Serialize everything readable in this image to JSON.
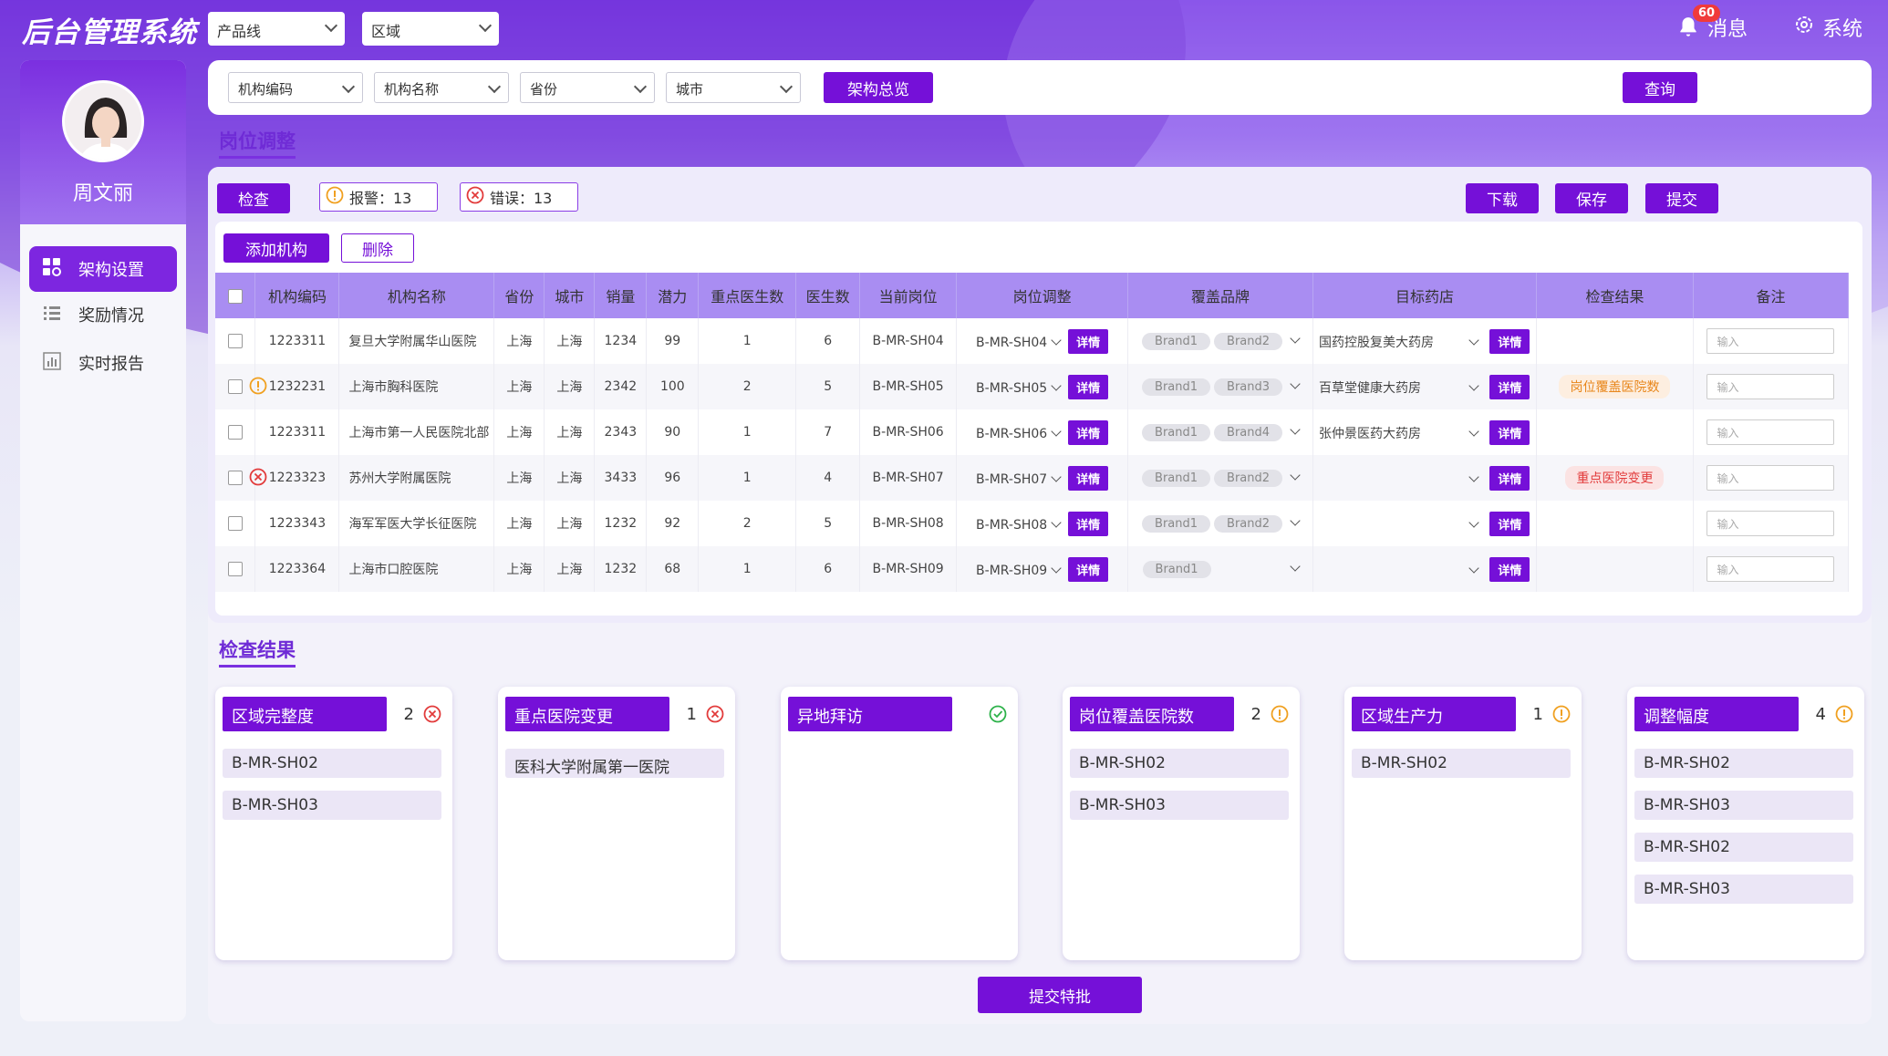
{
  "app": {
    "title": "后台管理系统",
    "product_line": "产品线",
    "region": "区域",
    "messages_label": "消息",
    "messages_count": "60",
    "system_label": "系统"
  },
  "user": {
    "name": "周文丽"
  },
  "nav": [
    {
      "label": "架构设置"
    },
    {
      "label": "奖励情况"
    },
    {
      "label": "实时报告"
    }
  ],
  "filters": {
    "org_code": "机构编码",
    "org_name": "机构名称",
    "province": "省份",
    "city": "城市",
    "overview_button": "架构总览",
    "query_button": "查询"
  },
  "section1": {
    "title": "岗位调整",
    "check_button": "检查",
    "warning_label": "报警：13",
    "error_label": "错误：13",
    "download_button": "下载",
    "save_button": "保存",
    "submit_button": "提交",
    "add_org_button": "添加机构",
    "delete_button": "删除"
  },
  "table": {
    "headers": [
      "机构编码",
      "机构名称",
      "省份",
      "城市",
      "销量",
      "潜力",
      "重点医生数",
      "医生数",
      "当前岗位",
      "岗位调整",
      "覆盖品牌",
      "目标药店",
      "检查结果",
      "备注"
    ],
    "detail_label": "详情",
    "remark_placeholder": "输入",
    "rows": [
      {
        "status": "",
        "code": "1223311",
        "name": "复旦大学附属华山医院",
        "province": "上海",
        "city": "上海",
        "sales": "1234",
        "potential": "99",
        "key_doctors": "1",
        "doctors": "6",
        "current": "B-MR-SH04",
        "adjust": "B-MR-SH04",
        "brand1": "Brand1",
        "brand2": "Brand2",
        "pharmacy": "国药控股复美大药房",
        "result": ""
      },
      {
        "status": "warning",
        "code": "1232231",
        "name": "上海市胸科医院",
        "province": "上海",
        "city": "上海",
        "sales": "2342",
        "potential": "100",
        "key_doctors": "2",
        "doctors": "5",
        "current": "B-MR-SH05",
        "adjust": "B-MR-SH05",
        "brand1": "Brand1",
        "brand2": "Brand3",
        "pharmacy": "百草堂健康大药房",
        "result": "岗位覆盖医院数",
        "result_type": "orange"
      },
      {
        "status": "",
        "code": "1223311",
        "name": "上海市第一人民医院北部",
        "province": "上海",
        "city": "上海",
        "sales": "2343",
        "potential": "90",
        "key_doctors": "1",
        "doctors": "7",
        "current": "B-MR-SH06",
        "adjust": "B-MR-SH06",
        "brand1": "Brand1",
        "brand2": "Brand4",
        "pharmacy": "张仲景医药大药房",
        "result": ""
      },
      {
        "status": "error",
        "code": "1223323",
        "name": "苏州大学附属医院",
        "province": "上海",
        "city": "上海",
        "sales": "3433",
        "potential": "96",
        "key_doctors": "1",
        "doctors": "4",
        "current": "B-MR-SH07",
        "adjust": "B-MR-SH07",
        "brand1": "Brand1",
        "brand2": "Brand2",
        "pharmacy": "",
        "result": "重点医院变更",
        "result_type": "red"
      },
      {
        "status": "",
        "code": "1223343",
        "name": "海军军医大学长征医院",
        "province": "上海",
        "city": "上海",
        "sales": "1232",
        "potential": "92",
        "key_doctors": "2",
        "doctors": "5",
        "current": "B-MR-SH08",
        "adjust": "B-MR-SH08",
        "brand1": "Brand1",
        "brand2": "Brand2",
        "pharmacy": "",
        "result": ""
      },
      {
        "status": "",
        "code": "1223364",
        "name": "上海市口腔医院",
        "province": "上海",
        "city": "上海",
        "sales": "1232",
        "potential": "68",
        "key_doctors": "1",
        "doctors": "6",
        "current": "B-MR-SH09",
        "adjust": "B-MR-SH09",
        "brand1": "Brand1",
        "brand2": "",
        "pharmacy": "",
        "result": ""
      }
    ]
  },
  "section2": {
    "title": "检查结果",
    "submit_special": "提交特批"
  },
  "cards": [
    {
      "title": "区域完整度",
      "count": "2",
      "status": "error",
      "items": [
        "B-MR-SH02",
        "B-MR-SH03"
      ]
    },
    {
      "title": "重点医院变更",
      "count": "1",
      "status": "error",
      "items": [
        "医科大学附属第一医院"
      ]
    },
    {
      "title": "异地拜访",
      "count": "",
      "status": "ok",
      "items": []
    },
    {
      "title": "岗位覆盖医院数",
      "count": "2",
      "status": "warning",
      "items": [
        "B-MR-SH02",
        "B-MR-SH03"
      ]
    },
    {
      "title": "区域生产力",
      "count": "1",
      "status": "warning",
      "items": [
        "B-MR-SH02"
      ]
    },
    {
      "title": "调整幅度",
      "count": "4",
      "status": "warning",
      "items": [
        "B-MR-SH02",
        "B-MR-SH03",
        "B-MR-SH02",
        "B-MR-SH03"
      ]
    }
  ],
  "colors": {
    "accent": "#7510d8",
    "warning": "#f0a020",
    "error": "#e23b3b",
    "ok": "#2db24a"
  }
}
